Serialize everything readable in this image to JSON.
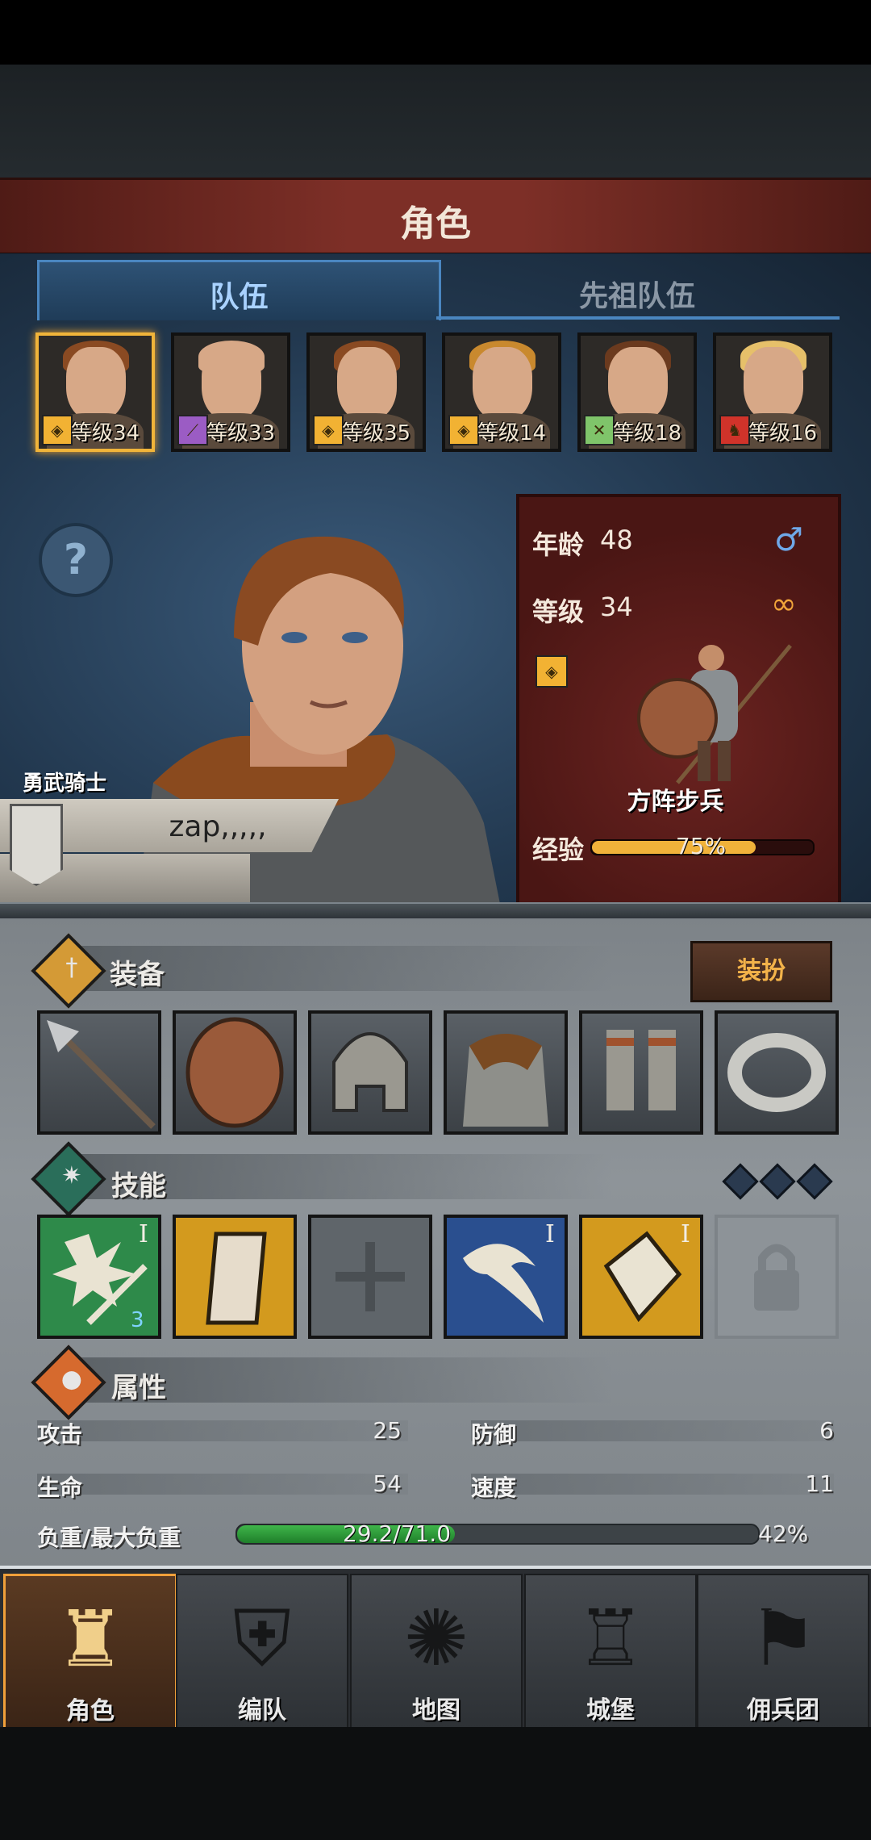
{
  "title": "角色",
  "tabs": {
    "team": "队伍",
    "ancestor": "先祖队伍"
  },
  "roster": [
    {
      "level": "等级34",
      "hair": "#8a4a22",
      "icon": "shield-icon",
      "icon_color": "#f2b233",
      "glyph": "◈"
    },
    {
      "level": "等级33",
      "hair": "#d7a887",
      "icon": "staff-icon",
      "icon_color": "#9b5cc4",
      "glyph": "⟋"
    },
    {
      "level": "等级35",
      "hair": "#8a4a22",
      "icon": "shield-icon",
      "icon_color": "#f2b233",
      "glyph": "◈"
    },
    {
      "level": "等级14",
      "hair": "#c9892e",
      "icon": "shield-icon",
      "icon_color": "#f2b233",
      "glyph": "◈"
    },
    {
      "level": "等级18",
      "hair": "#6b3a1e",
      "icon": "crossed-swords-icon",
      "icon_color": "#7fc46a",
      "glyph": "✕"
    },
    {
      "level": "等级16",
      "hair": "#e6c06a",
      "icon": "horse-icon",
      "icon_color": "#d0332a",
      "glyph": "♞"
    }
  ],
  "hero": {
    "title_tag": "勇武骑士",
    "name": "zap,,,,,",
    "age_label": "年龄",
    "age": "48",
    "level_label": "等级",
    "level": "34",
    "unit_name": "方阵步兵",
    "exp_label": "经验",
    "exp_value": "75%",
    "exp_fraction": 0.75
  },
  "equipment": {
    "title": "装备",
    "dress_button": "装扮",
    "slots": [
      "spear-icon",
      "round-shield-icon",
      "helmet-icon",
      "chainmail-icon",
      "boots-icon",
      "ring-icon"
    ]
  },
  "skills": {
    "title": "技能",
    "slots": [
      {
        "name": "burst-strike-skill-icon",
        "tier": "I",
        "badge": "3",
        "bg": "#2e8a4a"
      },
      {
        "name": "tower-shield-skill-icon",
        "tier": "",
        "badge": "",
        "bg": "#d39a1e"
      },
      {
        "name": "empty-skill-slot-icon",
        "tier": "",
        "badge": "",
        "bg": "#5f656a"
      },
      {
        "name": "charge-skill-icon",
        "tier": "I",
        "badge": "",
        "bg": "#2a4f8f"
      },
      {
        "name": "shield-break-skill-icon",
        "tier": "I",
        "badge": "",
        "bg": "#d39a1e"
      },
      {
        "name": "lock-icon",
        "tier": "",
        "badge": "",
        "bg": "#8d9398"
      }
    ]
  },
  "attributes": {
    "title": "属性",
    "attack_label": "攻击",
    "attack": "25",
    "defense_label": "防御",
    "defense": "6",
    "hp_label": "生命",
    "hp": "54",
    "speed_label": "速度",
    "speed": "11",
    "load_label": "负重/最大负重",
    "load": "29.2/71.0",
    "load_percent": "42%",
    "load_fraction": 0.42
  },
  "nav": [
    {
      "label": "角色",
      "icon": "knight-icon",
      "glyph": "♜"
    },
    {
      "label": "编队",
      "icon": "helmet-group-icon",
      "glyph": "⛨"
    },
    {
      "label": "地图",
      "icon": "compass-icon",
      "glyph": "✺"
    },
    {
      "label": "城堡",
      "icon": "castle-icon",
      "glyph": "♖"
    },
    {
      "label": "佣兵团",
      "icon": "mercenary-banner-icon",
      "glyph": "⚑"
    }
  ]
}
